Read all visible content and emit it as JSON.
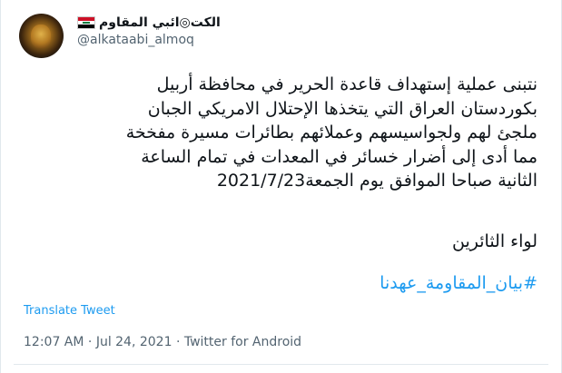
{
  "author": {
    "display_name": "الكت◎ائبي المقاوم",
    "handle": "@alkataabi_almoq",
    "flag_icon": "iraq-flag-icon"
  },
  "tweet": {
    "lines": [
      "نتبنى عملية إستهداف قاعدة الحرير في محافظة أربيل",
      "بكوردستان العراق التي يتخذها الإحتلال الامريكي الجبان",
      "ملجئ لهم ولجواسيسهم وعملائهم بطائرات مسيرة مفخخة",
      "مما أدى إلى أضرار خسائر في المعدات في تمام الساعة",
      "الثانية صباحا الموافق يوم الجمعة2021/7/23"
    ],
    "signature": "لواء الثائرين",
    "hashtag": "#بيان_المقاومة_عهدنا"
  },
  "translate_label": "Translate Tweet",
  "meta": {
    "time": "12:07 AM",
    "separator1": " · ",
    "date": "Jul 24, 2021",
    "separator2": " · ",
    "source": "Twitter for Android"
  },
  "colors": {
    "link": "#1d9bf0",
    "muted": "#536471",
    "text": "#0f1419"
  }
}
